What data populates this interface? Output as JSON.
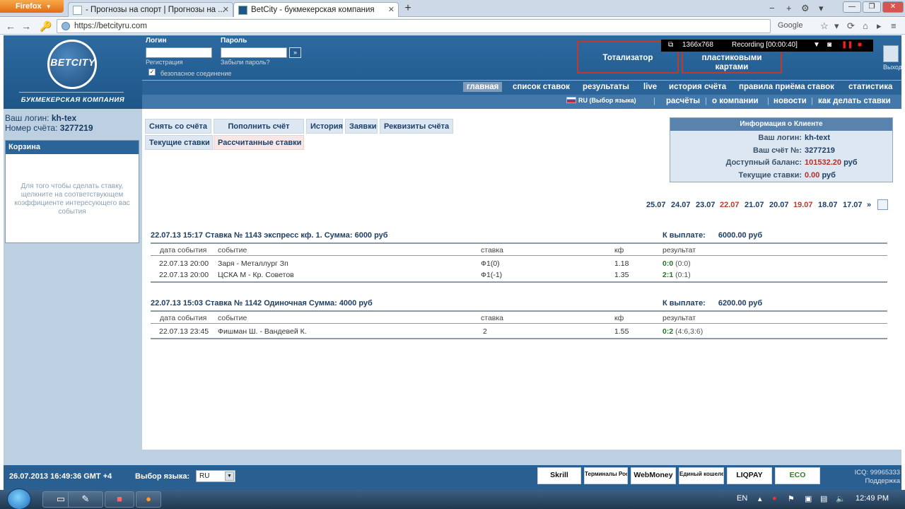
{
  "browser": {
    "menu_label": "Firefox",
    "tabs": [
      {
        "title": "- Прогнозы на спорт | Прогнозы на ..."
      },
      {
        "title": "BetCity - букмекерская компания"
      }
    ],
    "url": "https://betcityru.com",
    "search_engine": "Google"
  },
  "recorder": {
    "resolution": "1366x768",
    "status": "Recording [00:00:40]"
  },
  "site": {
    "brand": "BETCITY",
    "tagline": "БУКМЕКЕРСКАЯ КОМПАНИЯ",
    "login": {
      "login_label": "Логин",
      "password_label": "Пароль",
      "register_link": "Регистрация",
      "forgot_link": "Забыли пароль?",
      "submit": "»",
      "secure_label": "безопасное соединение",
      "secure_checked": "✓"
    },
    "promo_boxes": [
      "Тотализатор",
      "пластиковыми картами"
    ],
    "exit_label": "Выход",
    "menu_main": [
      "главная",
      "список ставок",
      "результаты",
      "live",
      "история счёта",
      "правила приёма ставок",
      "статистика"
    ],
    "lang_select": "RU (Выбор языка)",
    "menu_secondary": [
      "расчёты",
      "о компании",
      "новости",
      "как делать ставки"
    ],
    "user": {
      "login_label": "Ваш логин:",
      "login": "kh-tex",
      "account_label": "Номер счёта:",
      "account": "3277219"
    },
    "basket": {
      "title": "Корзина",
      "text": "Для того чтобы сделать ставку, щелкните на соответствующем коэффициенте интересующего вас события"
    },
    "account_buttons": {
      "row1": [
        "Снять со счёта",
        "Пополнить счёт",
        "История",
        "Заявки",
        "Реквизиты счёта"
      ],
      "row2": [
        "Текущие ставки",
        "Рассчитанные ставки"
      ]
    },
    "client_info": {
      "title": "Информация о Клиенте",
      "rows": [
        {
          "label": "Ваш логин:",
          "value": "kh-text"
        },
        {
          "label": "Ваш счёт №:",
          "value": "3277219"
        },
        {
          "label": "Доступный баланс:",
          "value": "101532.20",
          "currency": "руб"
        },
        {
          "label": "Текущие ставки:",
          "value": "0.00",
          "currency": "руб"
        }
      ],
      "value_color": "#b3302a"
    },
    "dates": [
      "25.07",
      "24.07",
      "23.07",
      "22.07",
      "21.07",
      "20.07",
      "19.07",
      "18.07",
      "17.07",
      "»"
    ],
    "bets": [
      {
        "header": "22.07.13 15:17  Ставка № 1143   экспресс  кф. 1.   Сумма: 6000 руб",
        "payout_label": "К выплате:",
        "payout": "6000.00 руб",
        "columns": [
          "дата события",
          "событие",
          "ставка",
          "кф",
          "результат"
        ],
        "rows": [
          {
            "date": "22.07.13 20:00",
            "event": "Заря - Металлург Зп",
            "bet": "Ф1(0)",
            "kf": "1.18",
            "score": "0:0",
            "detail": "(0:0)"
          },
          {
            "date": "22.07.13 20:00",
            "event": "ЦСКА М - Кр. Советов",
            "bet": "Ф1(-1)",
            "kf": "1.35",
            "score": "2:1",
            "detail": "(0:1)"
          }
        ]
      },
      {
        "header": "22.07.13 15:03  Ставка № 1142   Одиночная   Сумма: 4000 руб",
        "payout_label": "К выплате:",
        "payout": "6200.00 руб",
        "columns": [
          "дата события",
          "событие",
          "ставка",
          "кф",
          "результат"
        ],
        "rows": [
          {
            "date": "22.07.13 23:45",
            "event": "Фишман Ш. - Вандевей К.",
            "bet": "2",
            "kf": "1.55",
            "score": "0:2",
            "detail": "(4:6,3:6)"
          }
        ]
      }
    ],
    "footer": {
      "datetime": "26.07.2013  16:49:36  GMT +4",
      "lang_label": "Выбор языка:",
      "lang_value": "RU",
      "payments": [
        "Skrill",
        "Терминалы России",
        "WebMoney",
        "Единый кошелек",
        "LIQPAY",
        "ECO"
      ],
      "icq": "ICQ: 99965333",
      "support": "Поддержка"
    }
  },
  "taskbar": {
    "lang": "EN",
    "time": "12:49 PM"
  }
}
